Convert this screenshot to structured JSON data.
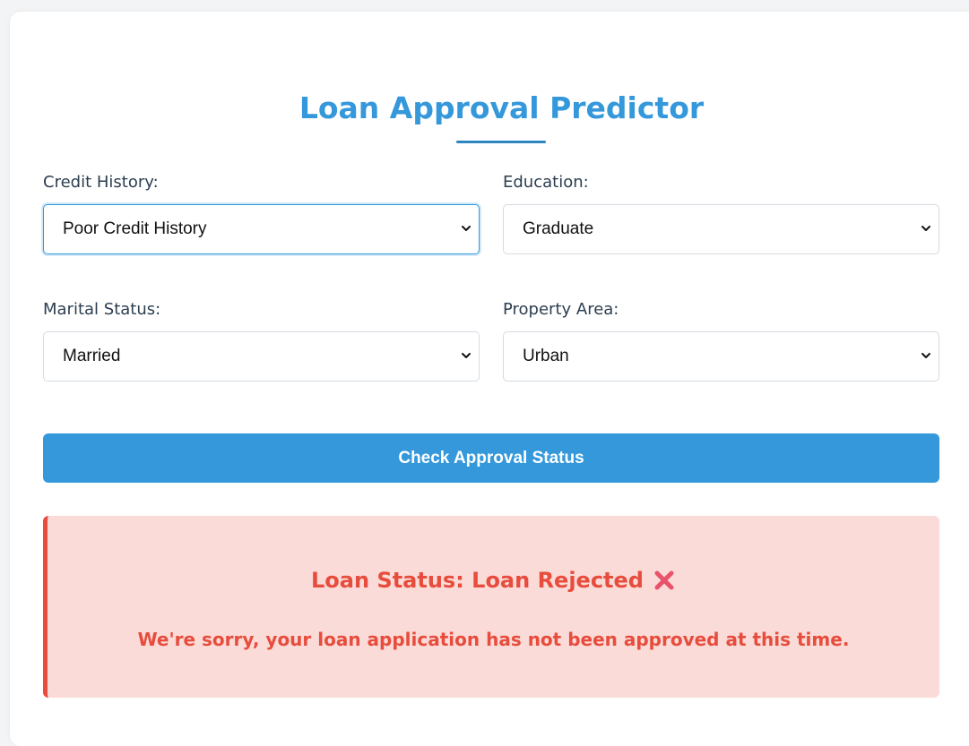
{
  "page": {
    "title": "Loan Approval Predictor"
  },
  "form": {
    "credit_history": {
      "label": "Credit History:",
      "selected": "Poor Credit History"
    },
    "education": {
      "label": "Education:",
      "selected": "Graduate"
    },
    "marital_status": {
      "label": "Marital Status:",
      "selected": "Married"
    },
    "property_area": {
      "label": "Property Area:",
      "selected": "Urban"
    },
    "submit_label": "Check Approval Status"
  },
  "result": {
    "status_text": "Loan Status: Loan Rejected",
    "status_icon": "cross-mark-icon",
    "message": "We're sorry, your loan application has not been approved at this time."
  },
  "colors": {
    "accent": "#3498db",
    "error": "#e74c3c",
    "error_bg": "#fadbd8"
  }
}
